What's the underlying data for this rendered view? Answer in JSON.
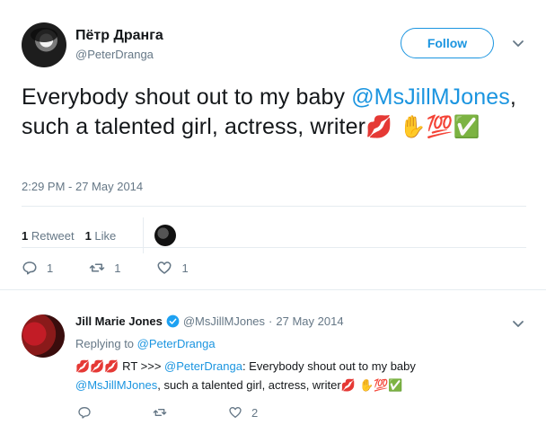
{
  "tweet": {
    "author_name": "Пётр Дранга",
    "author_handle": "@PeterDranga",
    "follow_label": "Follow",
    "text_before": "Everybody shout out to my baby ",
    "mention": "@MsJillMJones",
    "text_after": ", such a talented girl, actress, writer",
    "emojis": "💋 ✋💯✅",
    "timestamp": "2:29 PM - 27 May 2014",
    "retweet_count": "1",
    "retweet_label": "Retweet",
    "like_count": "1",
    "like_label": "Like",
    "actions": {
      "reply_count": "1",
      "retweet_count": "1",
      "like_count": "1"
    }
  },
  "reply": {
    "author_name": "Jill Marie Jones",
    "author_handle": "@MsJillMJones",
    "separator": "·",
    "date": "27 May 2014",
    "replying_prefix": "Replying to",
    "replying_to": "@PeterDranga",
    "lead_emojis": "💋💋💋",
    "rt_text": " RT >>> ",
    "rt_mention": "@PeterDranga",
    "rt_text2": ": Everybody shout out to my baby",
    "mention2": "@MsJillMJones",
    "text_after": ", such a talented girl, actress, writer",
    "trail_emojis": "💋 ✋💯✅",
    "actions": {
      "reply_count": "",
      "retweet_count": "",
      "like_count": "2"
    }
  },
  "colors": {
    "accent": "#1b95e0",
    "muted": "#657786",
    "text": "#14171a",
    "divider": "#e6ecf0"
  }
}
